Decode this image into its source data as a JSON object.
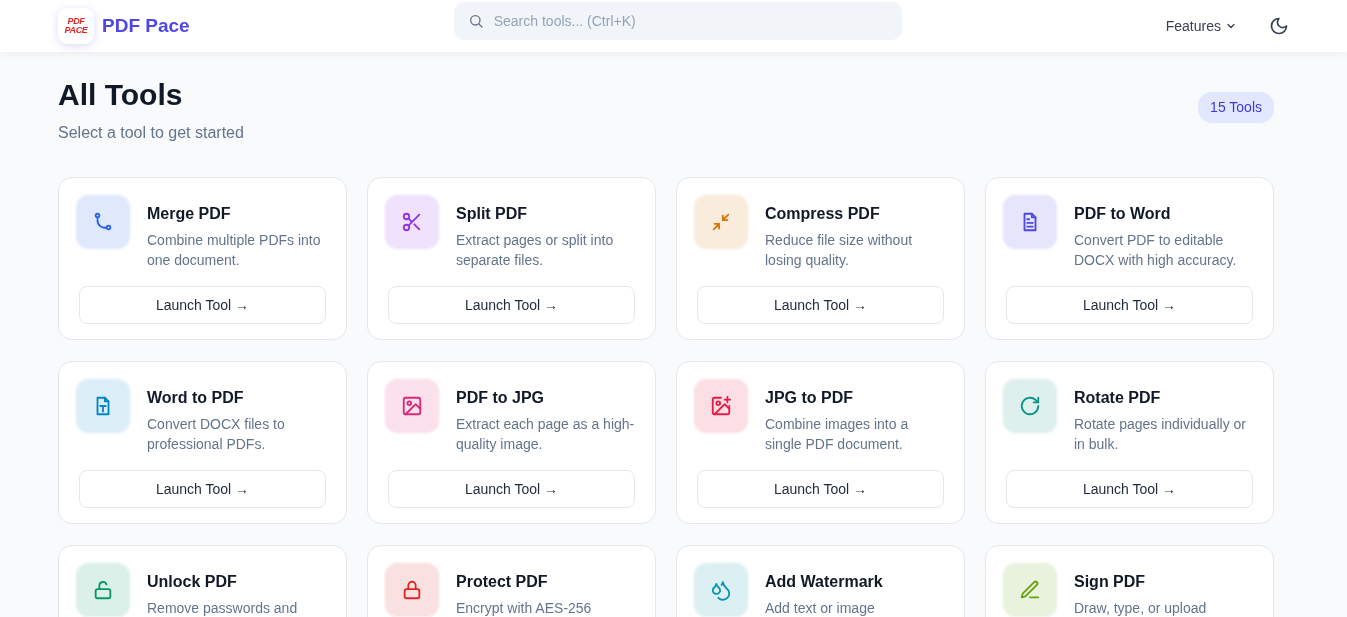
{
  "brand": {
    "name": "PDF Pace",
    "logo_text": "PDF PACE"
  },
  "search": {
    "placeholder": "Search tools... (Ctrl+K)"
  },
  "nav": {
    "features": "Features"
  },
  "heading": {
    "title": "All Tools",
    "subtitle": "Select a tool to get started",
    "count": "15 Tools"
  },
  "tools": [
    {
      "kind": "merge",
      "color": "#2563eb",
      "title": "Merge PDF",
      "description": "Combine multiple PDFs into one document.",
      "button": "Launch Tool →"
    },
    {
      "kind": "split",
      "color": "#9333ea",
      "title": "Split PDF",
      "description": "Extract pages or split into separate files.",
      "button": "Launch Tool →"
    },
    {
      "kind": "compress",
      "color": "#d97706",
      "title": "Compress PDF",
      "description": "Reduce file size without losing quality.",
      "button": "Launch Tool →"
    },
    {
      "kind": "document",
      "color": "#4f46e5",
      "title": "PDF to Word",
      "description": "Convert PDF to editable DOCX with high accuracy.",
      "button": "Launch Tool →"
    },
    {
      "kind": "text-file",
      "color": "#0284c7",
      "title": "Word to PDF",
      "description": "Convert DOCX files to professional PDFs.",
      "button": "Launch Tool →"
    },
    {
      "kind": "image",
      "color": "#db2777",
      "title": "PDF to JPG",
      "description": "Extract each page as a high-quality image.",
      "button": "Launch Tool →"
    },
    {
      "kind": "image-plus",
      "color": "#e11d48",
      "title": "JPG to PDF",
      "description": "Combine images into a single PDF document.",
      "button": "Launch Tool →"
    },
    {
      "kind": "rotate",
      "color": "#0d9488",
      "title": "Rotate PDF",
      "description": "Rotate pages individually or in bulk.",
      "button": "Launch Tool →"
    },
    {
      "kind": "unlock",
      "color": "#059669",
      "title": "Unlock PDF",
      "description": "Remove passwords and"
    },
    {
      "kind": "lock",
      "color": "#dc2626",
      "title": "Protect PDF",
      "description": "Encrypt with AES-256"
    },
    {
      "kind": "droplets",
      "color": "#0891b2",
      "title": "Add Watermark",
      "description": "Add text or image"
    },
    {
      "kind": "pen",
      "color": "#65a30d",
      "title": "Sign PDF",
      "description": "Draw, type, or upload"
    }
  ]
}
